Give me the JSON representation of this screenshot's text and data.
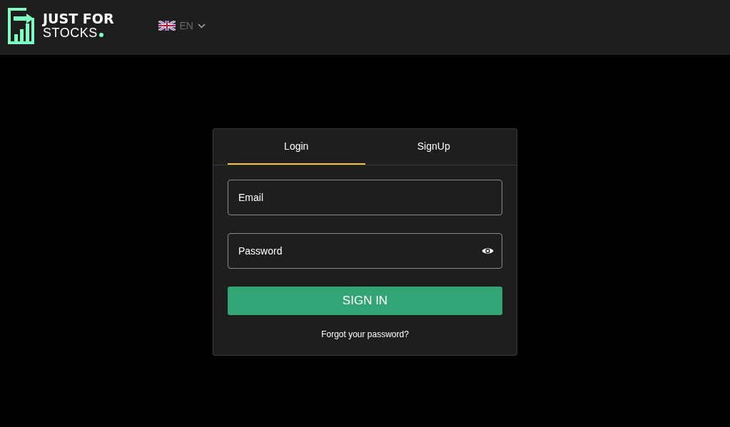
{
  "header": {
    "logo": {
      "line_1": "JUST FOR",
      "line_2": "STOCKS"
    },
    "language": {
      "code": "EN"
    }
  },
  "tabs": [
    {
      "label": "Login",
      "selected": true
    },
    {
      "label": "SignUp",
      "selected": false
    }
  ],
  "form": {
    "email": {
      "placeholder": "Email"
    },
    "password": {
      "placeholder": "Password"
    },
    "submit": "SIGN IN",
    "forgot_link": "Forgot your password?"
  }
}
